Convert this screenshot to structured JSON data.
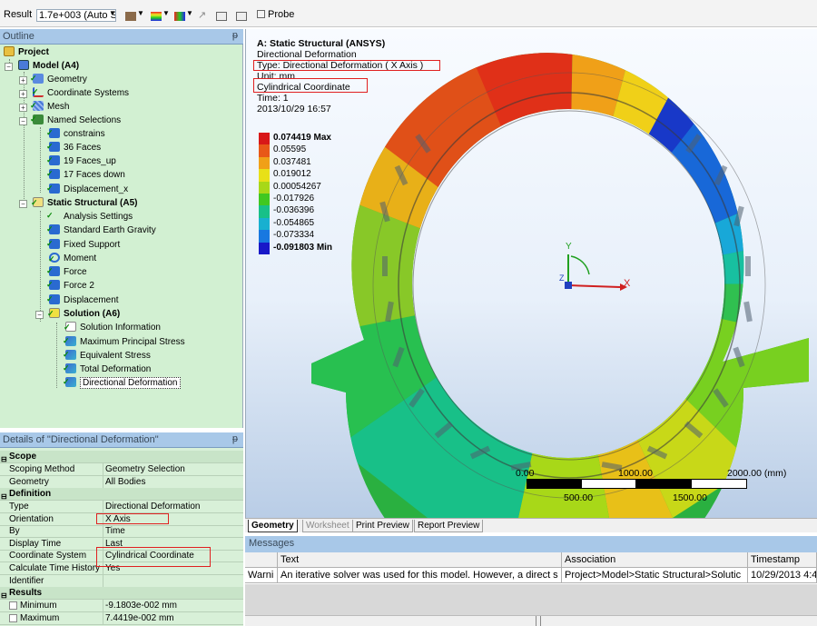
{
  "toolbar": {
    "result_label": "Result",
    "scale_value": "1.7e+003 (Auto S",
    "probe_label": "Probe"
  },
  "outline": {
    "title": "Outline",
    "pin": "ᵽ",
    "nodes": [
      {
        "label": "Project"
      },
      {
        "label": "Model (A4)"
      },
      {
        "label": "Geometry"
      },
      {
        "label": "Coordinate Systems"
      },
      {
        "label": "Mesh"
      },
      {
        "label": "Named Selections"
      },
      {
        "label": "constrains"
      },
      {
        "label": "36 Faces"
      },
      {
        "label": "19 Faces_up"
      },
      {
        "label": "17 Faces down"
      },
      {
        "label": "Displacement_x"
      },
      {
        "label": "Static Structural (A5)"
      },
      {
        "label": "Analysis Settings"
      },
      {
        "label": "Standard Earth Gravity"
      },
      {
        "label": "Fixed Support"
      },
      {
        "label": "Moment"
      },
      {
        "label": "Force"
      },
      {
        "label": "Force 2"
      },
      {
        "label": "Displacement"
      },
      {
        "label": "Solution (A6)"
      },
      {
        "label": "Solution Information"
      },
      {
        "label": "Maximum Principal Stress"
      },
      {
        "label": "Equivalent Stress"
      },
      {
        "label": "Total Deformation"
      },
      {
        "label": "Directional Deformation"
      }
    ]
  },
  "details": {
    "title": "Details of \"Directional Deformation\"",
    "pin": "ᵽ",
    "rows": [
      {
        "key": "Scope",
        "value": ""
      },
      {
        "key": "Scoping Method",
        "value": "Geometry Selection"
      },
      {
        "key": "Geometry",
        "value": "All Bodies"
      },
      {
        "key": "Definition",
        "value": ""
      },
      {
        "key": "Type",
        "value": "Directional Deformation"
      },
      {
        "key": "Orientation",
        "value": "X Axis"
      },
      {
        "key": "By",
        "value": "Time"
      },
      {
        "key": "Display Time",
        "value": "Last"
      },
      {
        "key": "Coordinate System",
        "value": "Cylindrical Coordinate"
      },
      {
        "key": "Calculate Time History",
        "value": "Yes"
      },
      {
        "key": "Identifier",
        "value": ""
      },
      {
        "key": "Results",
        "value": ""
      },
      {
        "key": "Minimum",
        "value": "-9.1803e-002 mm"
      },
      {
        "key": "Maximum",
        "value": "7.4419e-002 mm"
      }
    ]
  },
  "graphics": {
    "title": "A: Static Structural (ANSYS)",
    "subtitle": "Directional Deformation",
    "type_line": "Type: Directional Deformation ( X Axis )",
    "unit_line": "Unit: mm",
    "coord_line": "Cylindrical Coordinate",
    "time_line": "Time: 1",
    "date_line": "2013/10/29 16:57",
    "legend": [
      {
        "label": "0.074419 Max",
        "color": "#d81818"
      },
      {
        "label": "0.05595",
        "color": "#e85818"
      },
      {
        "label": "0.037481",
        "color": "#f0a018"
      },
      {
        "label": "0.019012",
        "color": "#e8e018"
      },
      {
        "label": "0.00054267",
        "color": "#a8d818"
      },
      {
        "label": "-0.017926",
        "color": "#40c820"
      },
      {
        "label": "-0.036396",
        "color": "#18c088"
      },
      {
        "label": "-0.054865",
        "color": "#18b0d0"
      },
      {
        "label": "-0.073334",
        "color": "#1878e0"
      },
      {
        "label": "-0.091803 Min",
        "color": "#1818c8"
      }
    ],
    "axis_x": "X",
    "axis_y": "Y",
    "axis_z": "Z",
    "scale_0": "0.00",
    "scale_1000": "1000.00",
    "scale_2000": "2000.00 (mm)",
    "scale_500": "500.00",
    "scale_1500": "1500.00"
  },
  "tabs": [
    "Geometry",
    "Worksheet",
    "Print Preview",
    "Report Preview"
  ],
  "messages": {
    "title": "Messages",
    "columns": [
      "Text",
      "Association",
      "Timestamp"
    ],
    "row": {
      "type": "Warni",
      "text": "An iterative solver was used for this model.  However, a direct s",
      "association": "Project>Model>Static Structural>Solutic",
      "timestamp": "10/29/2013 4:4"
    }
  }
}
